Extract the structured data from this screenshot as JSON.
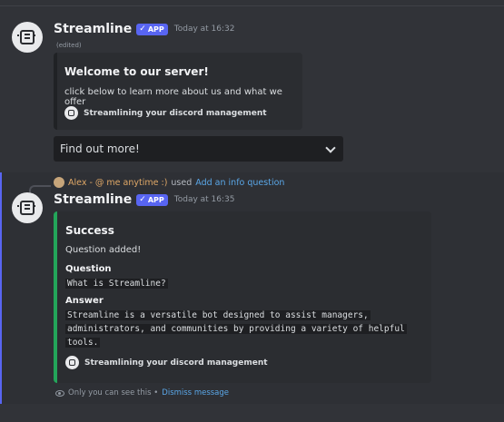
{
  "message1": {
    "username": "Streamline",
    "app_tag": "APP",
    "check": "✓",
    "timestamp": "Today at 16:32",
    "edited": "(edited)",
    "embed": {
      "title": "Welcome to our server!",
      "description": "click below to learn more about us and what we offer",
      "footer": "Streamlining your discord management"
    },
    "select": {
      "placeholder": "Find out more!"
    }
  },
  "reply": {
    "user": "Alex - @ me anytime :)",
    "used": "used",
    "command": "Add an info question"
  },
  "message2": {
    "username": "Streamline",
    "app_tag": "APP",
    "check": "✓",
    "timestamp": "Today at 16:35",
    "embed": {
      "title": "Success",
      "description": "Question added!",
      "fields": [
        {
          "name": "Question",
          "value_lines": [
            "What is Streamline?"
          ]
        },
        {
          "name": "Answer",
          "value_lines": [
            "Streamline is a versatile bot designed to assist managers,",
            "administrators, and communities by providing a variety of helpful",
            "tools."
          ]
        }
      ],
      "footer": "Streamlining your discord management"
    },
    "ephemeral": {
      "text": "Only you can see this •",
      "dismiss": "Dismiss message"
    }
  },
  "colors": {
    "accent": "#5865f2",
    "success": "#23a55a",
    "link": "#5aa7e8"
  }
}
